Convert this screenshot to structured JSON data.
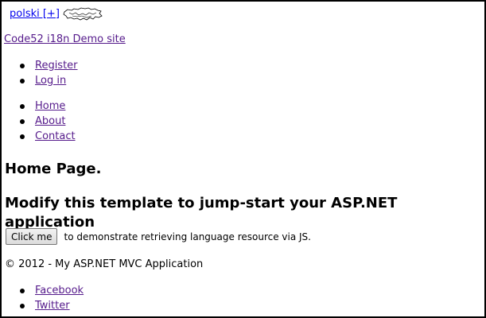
{
  "language": {
    "label": "polski [+]",
    "flag_icon": "poland-map-icon"
  },
  "site": {
    "title": "Code52 i18n Demo site"
  },
  "auth_links": [
    "Register",
    "Log in"
  ],
  "menu": [
    "Home",
    "About",
    "Contact"
  ],
  "main": {
    "heading": "Home Page.",
    "subheading": "Modify this template to jump-start your ASP.NET application",
    "button_label": "Click me",
    "button_note": "to demonstrate retrieving language resource via JS."
  },
  "footer": {
    "copyright": "© 2012 - My ASP.NET MVC Application",
    "social": [
      "Facebook",
      "Twitter"
    ]
  }
}
